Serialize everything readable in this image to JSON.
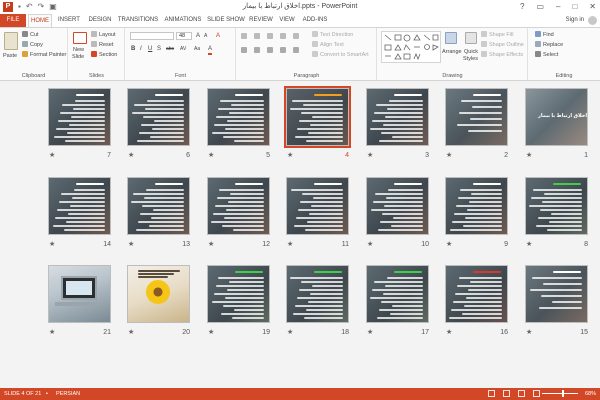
{
  "titlebar": {
    "app_icon": "P",
    "title": "اخلاق ارتباط با بیمار.ppts - PowerPoint",
    "qat_icons": [
      "save-icon",
      "undo-icon",
      "redo-icon",
      "start-from-beginning-icon"
    ],
    "window_buttons": {
      "help": "?",
      "ribbon_options": "▭",
      "minimize": "–",
      "maximize": "□",
      "close": "✕"
    }
  },
  "tabs": {
    "file": "FILE",
    "items": [
      "HOME",
      "INSERT",
      "DESIGN",
      "TRANSITIONS",
      "ANIMATIONS",
      "SLIDE SHOW",
      "REVIEW",
      "VIEW",
      "ADD-INS"
    ],
    "active": "HOME",
    "signin": "Sign in"
  },
  "ribbon": {
    "clipboard": {
      "label": "Clipboard",
      "paste": "Paste",
      "cut": "Cut",
      "copy": "Copy",
      "format_painter": "Format Painter"
    },
    "slides": {
      "label": "Slides",
      "new_slide_line1": "New",
      "new_slide_line2": "Slide",
      "layout": "Layout",
      "reset": "Reset",
      "section": "Section"
    },
    "font": {
      "label": "Font",
      "size": "48",
      "grow": "A",
      "shrink": "A",
      "clear": "A",
      "bold": "B",
      "italic": "I",
      "underline": "U",
      "shadow": "S",
      "strike": "abc",
      "spacing": "AV",
      "case": "Aa",
      "color": "A"
    },
    "paragraph": {
      "label": "Paragraph",
      "text_direction": "Text Direction",
      "align_text": "Align Text",
      "convert_smartart": "Convert to SmartArt"
    },
    "drawing": {
      "label": "Drawing",
      "arrange": "Arrange",
      "quick_styles_line1": "Quick",
      "quick_styles_line2": "Styles",
      "shape_fill": "Shape Fill",
      "shape_outline": "Shape Outline",
      "shape_effects": "Shape Effects"
    },
    "editing": {
      "label": "Editing",
      "find": "Find",
      "replace": "Replace",
      "select": "Select"
    }
  },
  "slides": [
    {
      "number": "7",
      "theme": "text",
      "row": 0,
      "col": 0
    },
    {
      "number": "6",
      "theme": "text",
      "row": 0,
      "col": 1
    },
    {
      "number": "5",
      "theme": "text",
      "row": 0,
      "col": 2
    },
    {
      "number": "4",
      "theme": "text-orange",
      "row": 0,
      "col": 3,
      "selected": true
    },
    {
      "number": "3",
      "theme": "text",
      "row": 0,
      "col": 4
    },
    {
      "number": "2",
      "theme": "bullets",
      "row": 0,
      "col": 5
    },
    {
      "number": "1",
      "theme": "title",
      "row": 0,
      "col": 6,
      "heading": "اخلاق ارتباط با بیمار"
    },
    {
      "number": "14",
      "theme": "text",
      "row": 1,
      "col": 0
    },
    {
      "number": "13",
      "theme": "text",
      "row": 1,
      "col": 1
    },
    {
      "number": "12",
      "theme": "text",
      "row": 1,
      "col": 2
    },
    {
      "number": "11",
      "theme": "text",
      "row": 1,
      "col": 3
    },
    {
      "number": "10",
      "theme": "text",
      "row": 1,
      "col": 4
    },
    {
      "number": "9",
      "theme": "text",
      "row": 1,
      "col": 5
    },
    {
      "number": "8",
      "theme": "text-green",
      "row": 1,
      "col": 6
    },
    {
      "number": "21",
      "theme": "laptop",
      "row": 2,
      "col": 0
    },
    {
      "number": "20",
      "theme": "flower",
      "row": 2,
      "col": 1
    },
    {
      "number": "19",
      "theme": "text-green",
      "row": 2,
      "col": 2
    },
    {
      "number": "18",
      "theme": "text-green",
      "row": 2,
      "col": 3
    },
    {
      "number": "17",
      "theme": "text-green",
      "row": 2,
      "col": 4
    },
    {
      "number": "16",
      "theme": "text-red",
      "row": 2,
      "col": 5
    },
    {
      "number": "15",
      "theme": "bullets",
      "row": 2,
      "col": 6
    }
  ],
  "status": {
    "slide_info": "SLIDE 4 OF 21",
    "language": "PERSIAN",
    "zoom": "68%"
  },
  "colors": {
    "accent": "#d24726",
    "slide_bg": "#4a5258",
    "green_title": "#3ecf4a",
    "red_title": "#e0362a",
    "orange_title": "#f0a020"
  }
}
